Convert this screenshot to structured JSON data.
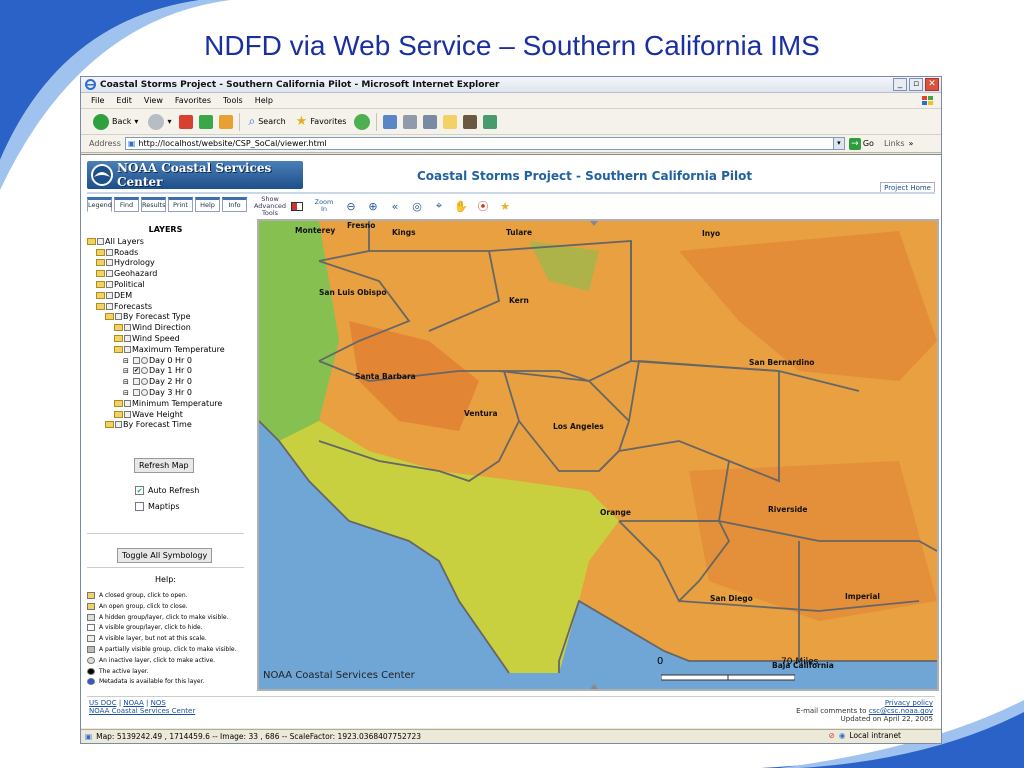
{
  "slide": {
    "title": "NDFD via Web Service – Southern California IMS"
  },
  "window": {
    "title": "Coastal Storms Project - Southern California Pilot - Microsoft Internet Explorer"
  },
  "menu": [
    "File",
    "Edit",
    "View",
    "Favorites",
    "Tools",
    "Help"
  ],
  "toolbar": {
    "back": "Back",
    "search": "Search",
    "favorites": "Favorites"
  },
  "address": {
    "label": "Address",
    "url": "http://localhost/website/CSP_SoCal/viewer.html",
    "go": "Go",
    "links": "Links"
  },
  "page": {
    "org_name": "NOAA Coastal Services Center",
    "project_title": "Coastal Storms Project - Southern California Pilot",
    "project_home": "Project Home",
    "tabs": [
      "Legend",
      "Find",
      "Results",
      "Print",
      "Help",
      "Info"
    ],
    "tools": {
      "advanced": "Show Advanced Tools",
      "zoom": "Zoom In"
    }
  },
  "layers": {
    "title": "LAYERS",
    "items": [
      "All Layers",
      "Roads",
      "Hydrology",
      "Geohazard",
      "Political",
      "DEM",
      "Forecasts",
      "By Forecast Type",
      "Wind Direction",
      "Wind Speed",
      "Maximum Temperature",
      "Day 0 Hr 0",
      "Day 1 Hr 0",
      "Day 2 Hr 0",
      "Day 3 Hr 0",
      "Minimum Temperature",
      "Wave Height",
      "By Forecast Time"
    ]
  },
  "controls": {
    "refresh": "Refresh Map",
    "auto_refresh": "Auto Refresh",
    "maptips": "Maptips",
    "toggle_symbology": "Toggle All Symbology",
    "help_title": "Help:"
  },
  "help_legend": [
    "A closed group, click to open.",
    "An open group, click to close.",
    "A hidden group/layer, click to make visible.",
    "A visible group/layer, click to hide.",
    "A visible layer, but not at this scale.",
    "A partially visible group, click to make visible.",
    "An inactive layer, click to make active.",
    "The active layer.",
    "Metadata is available for this layer."
  ],
  "map": {
    "counties": [
      "Monterey",
      "Fresno",
      "Kings",
      "Tulare",
      "Inyo",
      "San Luis Obispo",
      "Kern",
      "San Bernardino",
      "Santa Barbara",
      "Ventura",
      "Los Angeles",
      "Orange",
      "Riverside",
      "San Diego",
      "Imperial",
      "Baja California"
    ],
    "credit": "NOAA Coastal Services Center",
    "scale_start": "0",
    "scale_end": "70 Miles",
    "colors": {
      "ocean": "#6fa6d6",
      "warm": "#e8a040",
      "hot": "#e07a30",
      "mild": "#c8d040",
      "cool": "#86c050"
    }
  },
  "footer": {
    "links": [
      "US DOC",
      "NOAA",
      "NOS"
    ],
    "org": "NOAA Coastal Services Center",
    "privacy": "Privacy policy",
    "email_prefix": "E-mail comments to",
    "email": "csc@csc.noaa.gov",
    "updated": "Updated on April 22, 2005"
  },
  "status": {
    "text": "Map: 5139242.49 , 1714459.6 -- Image: 33 , 686 -- ScaleFactor: 1923.0368407752723",
    "zone": "Local intranet"
  }
}
